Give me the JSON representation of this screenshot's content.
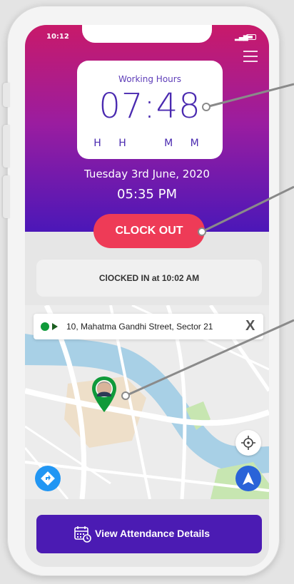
{
  "status_bar": {
    "time": "10:12"
  },
  "working_hours": {
    "label": "Working Hours",
    "value": "07:48",
    "units": "H H   M M"
  },
  "date": "Tuesday 3rd June, 2020",
  "current_time": "05:35 PM",
  "clock_out_label": "CLOCK OUT",
  "clocked_status": "ClOCKED IN at 10:02 AM",
  "map": {
    "address": "10, Mahatma Gandhi Street, Sector 21",
    "close_label": "X"
  },
  "footer": {
    "view_attendance_label": "View Attendance Details"
  },
  "colors": {
    "header_top": "#c81a6a",
    "header_bottom": "#4b17b8",
    "clock_out": "#ee3b57",
    "view_button": "#4b1bb3",
    "location_pin": "#0f9a3a"
  }
}
